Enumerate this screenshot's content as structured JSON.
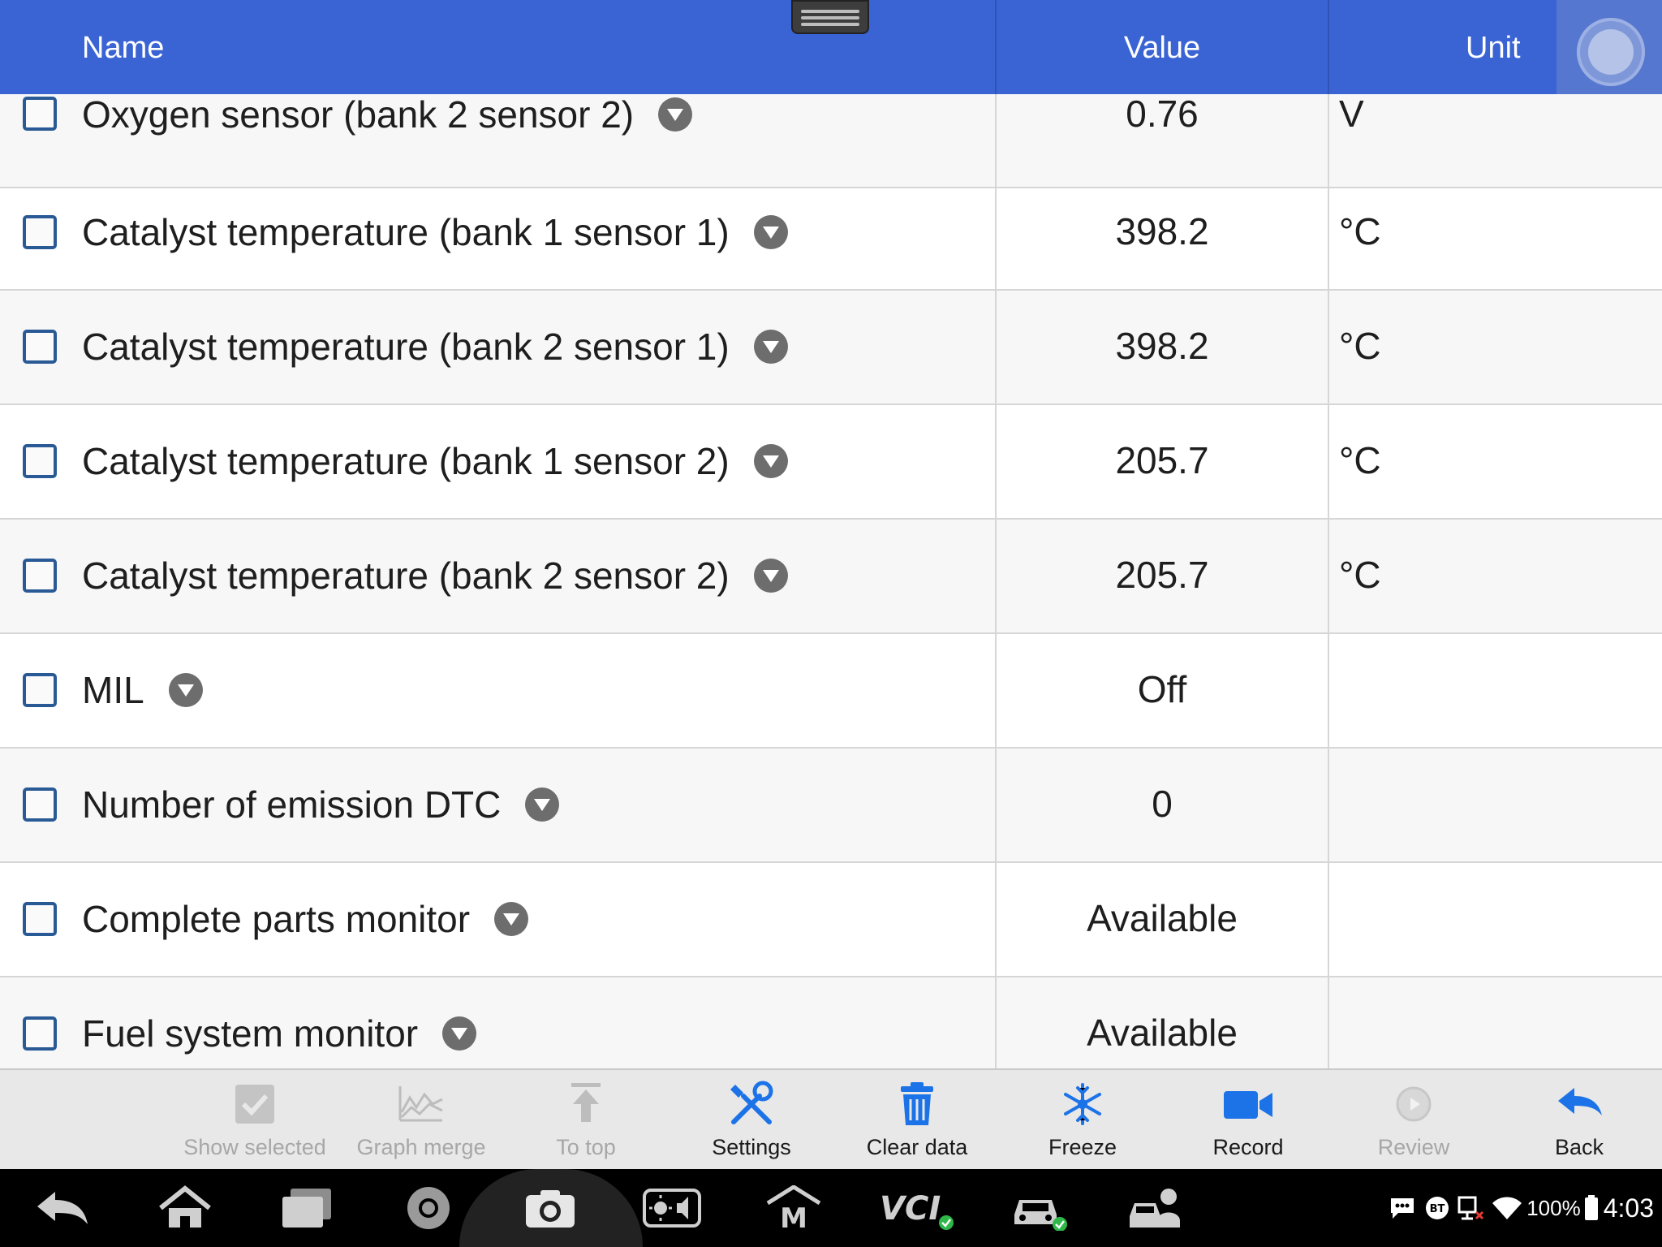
{
  "header": {
    "name_label": "Name",
    "value_label": "Value",
    "unit_label": "Unit"
  },
  "rows": [
    {
      "name": "Oxygen sensor (bank 2 sensor 2)",
      "value": "0.76",
      "unit": "V"
    },
    {
      "name": "Catalyst temperature (bank 1 sensor 1)",
      "value": "398.2",
      "unit": "°C"
    },
    {
      "name": "Catalyst temperature (bank 2 sensor 1)",
      "value": "398.2",
      "unit": "°C"
    },
    {
      "name": "Catalyst temperature (bank 1 sensor 2)",
      "value": "205.7",
      "unit": "°C"
    },
    {
      "name": "Catalyst temperature (bank 2 sensor 2)",
      "value": "205.7",
      "unit": "°C"
    },
    {
      "name": "MIL",
      "value": "Off",
      "unit": ""
    },
    {
      "name": "Number of emission DTC",
      "value": "0",
      "unit": ""
    },
    {
      "name": "Complete parts monitor",
      "value": "Available",
      "unit": ""
    },
    {
      "name": "Fuel system monitor",
      "value": "Available",
      "unit": ""
    }
  ],
  "toolbar": {
    "show_selected": "Show selected",
    "graph_merge": "Graph merge",
    "to_top": "To top",
    "settings": "Settings",
    "clear_data": "Clear data",
    "freeze": "Freeze",
    "record": "Record",
    "review": "Review",
    "back": "Back"
  },
  "status_bar": {
    "battery": "100%",
    "time": "4:03",
    "bt_label": "BT",
    "vci_label": "VCI"
  },
  "colors": {
    "header_blue": "#3a64d4",
    "accent_blue": "#1c73e8",
    "checkbox_border": "#2a5a96",
    "ok_green": "#2fb84a"
  }
}
